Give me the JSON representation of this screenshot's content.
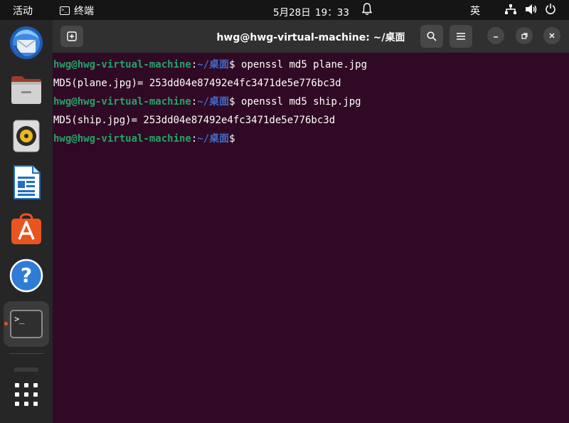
{
  "topbar": {
    "activities": "活动",
    "app_name": "终端",
    "clock": "5月28日  19：33",
    "language": "英"
  },
  "dock": {
    "items": [
      {
        "name": "thunderbird",
        "icon": "thunderbird-icon"
      },
      {
        "name": "files",
        "icon": "files-icon"
      },
      {
        "name": "rhythmbox",
        "icon": "rhythmbox-icon"
      },
      {
        "name": "libreoffice-writer",
        "icon": "writer-icon"
      },
      {
        "name": "app-center",
        "icon": "app-center-icon"
      },
      {
        "name": "help",
        "icon": "help-icon"
      },
      {
        "name": "terminal",
        "icon": "terminal-icon",
        "active": true
      },
      {
        "name": "show-apps",
        "icon": "grid-icon"
      }
    ]
  },
  "window": {
    "title": "hwg@hwg-virtual-machine: ~/桌面"
  },
  "terminal": {
    "prompt_user": "hwg@hwg-virtual-machine",
    "prompt_colon": ":",
    "prompt_path": "~/桌面",
    "prompt_dollar": "$",
    "commands": [
      " openssl md5 plane.jpg",
      " openssl md5 ship.jpg"
    ],
    "outputs": [
      "MD5(plane.jpg)= 253dd04e87492e4fc3471de5e776bc3d",
      "MD5(ship.jpg)= 253dd04e87492e4fc3471de5e776bc3d"
    ]
  },
  "colors": {
    "terminal_bg": "#300a24",
    "prompt_user": "#26a269",
    "prompt_path": "#12488b",
    "accent": "#e95420"
  }
}
